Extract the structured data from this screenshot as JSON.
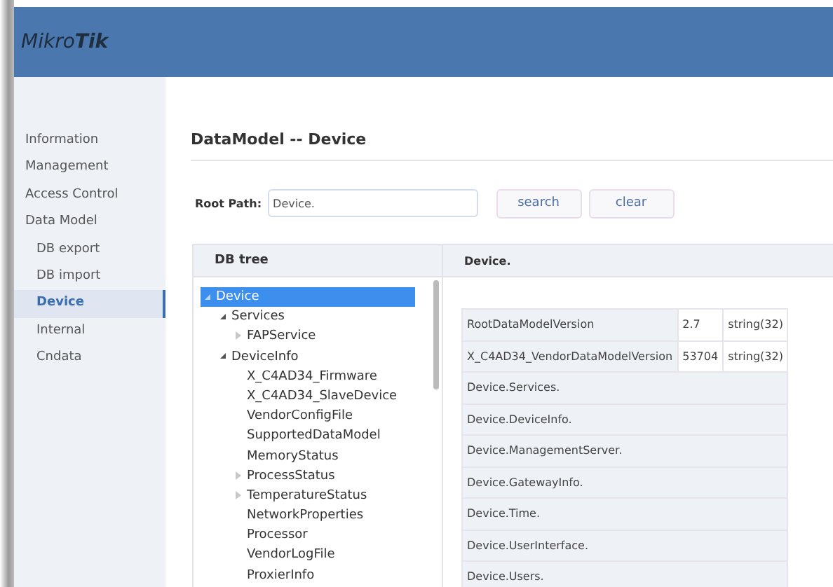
{
  "header": {
    "logo": {
      "light": "Mikro",
      "bold": "Tik"
    }
  },
  "sidebar": {
    "items": [
      {
        "label": "Information",
        "sub": false,
        "selected": false
      },
      {
        "label": "Management",
        "sub": false,
        "selected": false
      },
      {
        "label": "Access Control",
        "sub": false,
        "selected": false
      },
      {
        "label": "Data Model",
        "sub": false,
        "selected": false
      },
      {
        "label": "DB export",
        "sub": true,
        "selected": false
      },
      {
        "label": "DB import",
        "sub": true,
        "selected": false
      },
      {
        "label": "Device",
        "sub": true,
        "selected": true
      },
      {
        "label": "Internal",
        "sub": true,
        "selected": false
      },
      {
        "label": "Cndata",
        "sub": true,
        "selected": false
      }
    ]
  },
  "page": {
    "title": "DataModel -- Device"
  },
  "root_path": {
    "label": "Root Path:",
    "value": "Device.",
    "buttons": [
      "search",
      "clear"
    ]
  },
  "db_tree": {
    "heading": "DB tree",
    "nodes": [
      {
        "label": "Device",
        "selected": true,
        "expanded": true,
        "children": [
          {
            "label": "Services",
            "selected": false,
            "expanded": true,
            "children": [
              {
                "label": "FAPService",
                "selected": false,
                "expanded": false
              }
            ]
          },
          {
            "label": "DeviceInfo",
            "selected": false,
            "expanded": true,
            "children": [
              {
                "label": "X_C4AD34_Firmware",
                "selected": false
              },
              {
                "label": "X_C4AD34_SlaveDevice",
                "selected": false
              },
              {
                "label": "VendorConfigFile",
                "selected": false
              },
              {
                "label": "SupportedDataModel",
                "selected": false
              },
              {
                "label": "MemoryStatus",
                "selected": false
              },
              {
                "label": "ProcessStatus",
                "selected": false,
                "expanded": false
              },
              {
                "label": "TemperatureStatus",
                "selected": false,
                "expanded": false
              },
              {
                "label": "NetworkProperties",
                "selected": false
              },
              {
                "label": "Processor",
                "selected": false
              },
              {
                "label": "VendorLogFile",
                "selected": false
              },
              {
                "label": "ProxierInfo",
                "selected": false
              }
            ]
          }
        ]
      }
    ]
  },
  "details": {
    "heading": "Device.",
    "rows": [
      {
        "kind": "param",
        "name": "RootDataModelVersion",
        "value": "2.7",
        "type": "string(32)"
      },
      {
        "kind": "param",
        "name": "X_C4AD34_VendorDataModelVersion",
        "value": "53704",
        "type": "string(32)"
      },
      {
        "kind": "object",
        "name": "Device.Services."
      },
      {
        "kind": "object",
        "name": "Device.DeviceInfo."
      },
      {
        "kind": "object",
        "name": "Device.ManagementServer."
      },
      {
        "kind": "object",
        "name": "Device.GatewayInfo."
      },
      {
        "kind": "object",
        "name": "Device.Time."
      },
      {
        "kind": "object",
        "name": "Device.UserInterface."
      },
      {
        "kind": "object",
        "name": "Device.Users."
      }
    ]
  }
}
